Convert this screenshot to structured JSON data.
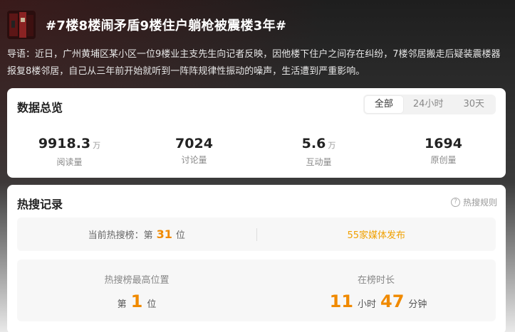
{
  "header": {
    "title": "#7楼8楼闹矛盾9楼住户躺枪被震楼3年#",
    "intro": "导语：近日，广州黄埔区某小区一位9楼业主支先生向记者反映，因他楼下住户之间存在纠纷，7楼邻居搬走后疑装震楼器报复8楼邻居，自己从三年前开始就听到一阵阵规律性振动的噪声，生活遭到严重影响。"
  },
  "overview": {
    "title": "数据总览",
    "tabs": [
      "全部",
      "24小时",
      "30天"
    ],
    "active_tab": "全部",
    "stats": [
      {
        "value": "9918.3",
        "unit": "万",
        "label": "阅读量"
      },
      {
        "value": "7024",
        "unit": "",
        "label": "讨论量"
      },
      {
        "value": "5.6",
        "unit": "万",
        "label": "互动量"
      },
      {
        "value": "1694",
        "unit": "",
        "label": "原创量"
      }
    ]
  },
  "hot": {
    "title": "热搜记录",
    "rules_label": "热搜规则",
    "current_rank_label": "当前热搜榜：",
    "current_rank_prefix": "第",
    "current_rank": "31",
    "current_rank_suffix": "位",
    "media_link": "55家媒体发布",
    "best_label": "热搜榜最高位置",
    "best_prefix": "第",
    "best_rank": "1",
    "best_suffix": "位",
    "duration_label": "在榜时长",
    "duration_hours": "11",
    "hours_unit": "小时",
    "duration_minutes": "47",
    "minutes_unit": "分钟"
  },
  "colors": {
    "accent": "#f08a00",
    "link": "#f0a000"
  }
}
